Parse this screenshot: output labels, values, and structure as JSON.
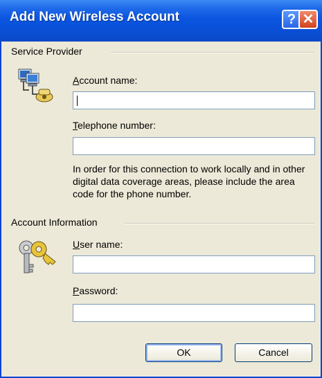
{
  "window": {
    "title": "Add New Wireless Account",
    "help_glyph": "?",
    "close_glyph": "✕"
  },
  "service_provider": {
    "heading": "Service Provider",
    "icon": "network-computers-phone-icon",
    "account_name": {
      "label_access": "A",
      "label_rest": "ccount name:",
      "value": ""
    },
    "telephone": {
      "label_access": "T",
      "label_rest": "elephone number:",
      "value": ""
    },
    "info_text": "In order for this connection to work locally and in other digital data coverage areas, please include the area code for the phone number."
  },
  "account_information": {
    "heading": "Account Information",
    "icon": "keys-icon",
    "user_name": {
      "label_access": "U",
      "label_rest": "ser name:",
      "value": ""
    },
    "password": {
      "label_access": "P",
      "label_rest": "assword:",
      "value": ""
    }
  },
  "buttons": {
    "ok": "OK",
    "cancel": "Cancel"
  }
}
